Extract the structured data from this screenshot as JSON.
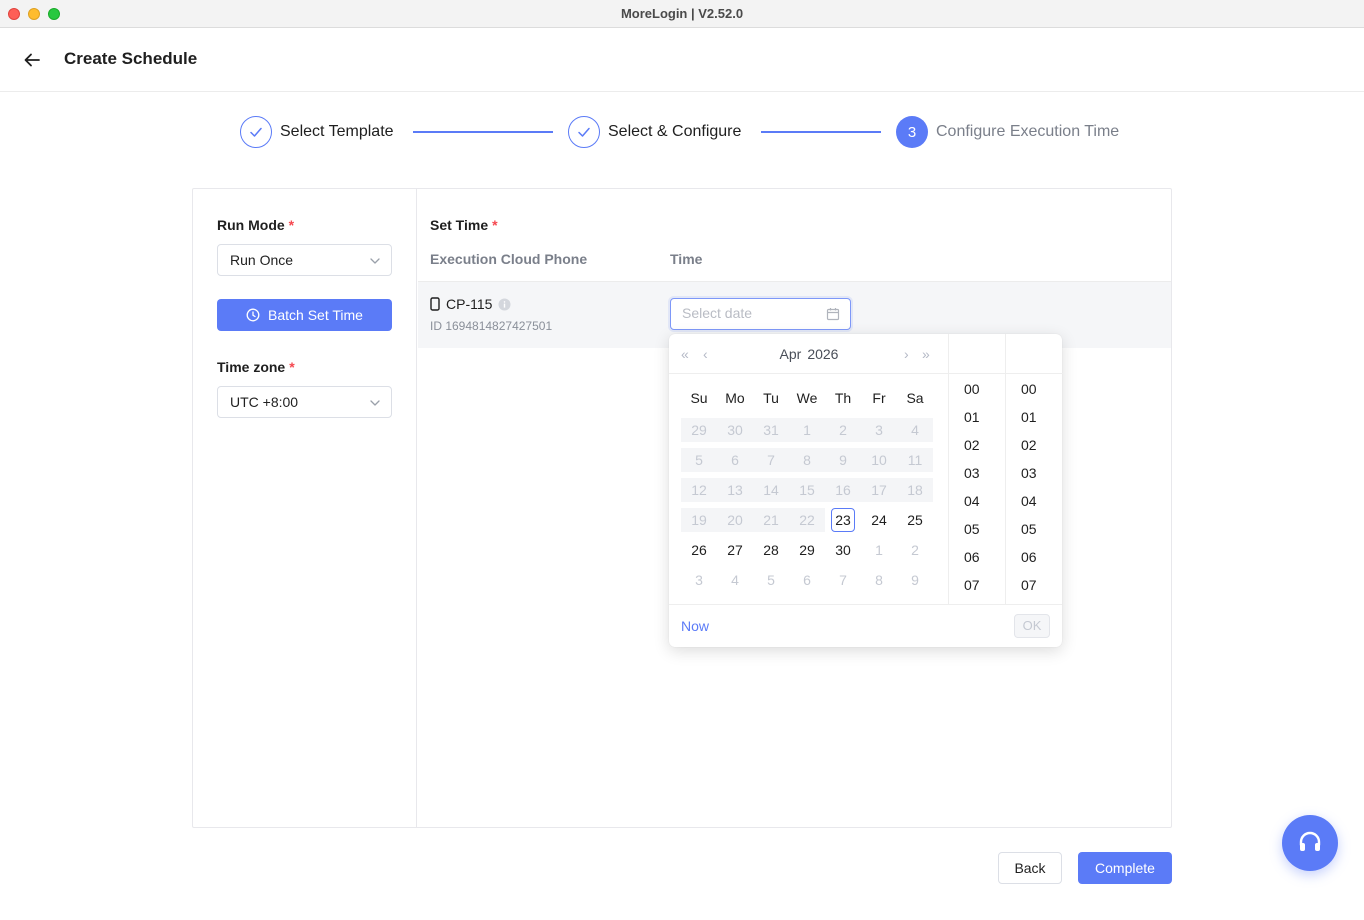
{
  "window": {
    "title": "MoreLogin | V2.52.0"
  },
  "header": {
    "title": "Create Schedule"
  },
  "steps": [
    {
      "label": "Select Template",
      "state": "done"
    },
    {
      "label": "Select & Configure",
      "state": "done"
    },
    {
      "number": "3",
      "label": "Configure Execution Time",
      "state": "active"
    }
  ],
  "left": {
    "run_mode_label": "Run Mode",
    "run_mode_value": "Run Once",
    "batch_button": "Batch Set Time",
    "timezone_label": "Time zone",
    "timezone_value": "UTC +8:00",
    "required_mark": "*"
  },
  "right": {
    "set_time_label": "Set Time",
    "columns": [
      "Execution Cloud Phone",
      "Time"
    ],
    "row": {
      "name": "CP-115",
      "id": "ID 1694814827427501",
      "date_placeholder": "Select date"
    }
  },
  "picker": {
    "month": "Apr",
    "year": "2026",
    "weekdays": [
      "Su",
      "Mo",
      "Tu",
      "We",
      "Th",
      "Fr",
      "Sa"
    ],
    "weeks": [
      [
        "29",
        "30",
        "31",
        "1",
        "2",
        "3",
        "4"
      ],
      [
        "5",
        "6",
        "7",
        "8",
        "9",
        "10",
        "11"
      ],
      [
        "12",
        "13",
        "14",
        "15",
        "16",
        "17",
        "18"
      ],
      [
        "19",
        "20",
        "21",
        "22",
        "23",
        "24",
        "25"
      ],
      [
        "26",
        "27",
        "28",
        "29",
        "30",
        "1",
        "2"
      ],
      [
        "3",
        "4",
        "5",
        "6",
        "7",
        "8",
        "9"
      ]
    ],
    "hours": [
      "00",
      "01",
      "02",
      "03",
      "04",
      "05",
      "06",
      "07"
    ],
    "minutes": [
      "00",
      "01",
      "02",
      "03",
      "04",
      "05",
      "06",
      "07"
    ],
    "now_label": "Now",
    "ok_label": "OK"
  },
  "footer": {
    "back_label": "Back",
    "complete_label": "Complete"
  },
  "colors": {
    "accent": "#5b7bf7",
    "required": "#f5474f"
  }
}
